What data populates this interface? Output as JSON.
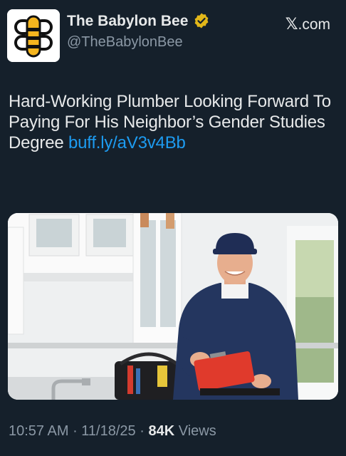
{
  "account": {
    "display_name": "The Babylon Bee",
    "handle": "@TheBabylonBee",
    "verified_icon": "gold-verified-badge-icon",
    "avatar_icon": "bee-logo-icon"
  },
  "source": {
    "x_glyph": "𝕏",
    "label": ".com"
  },
  "tweet": {
    "text": "Hard-Working Plumber Looking Forward To Paying For His Neighbor’s Gender Studies Degree ",
    "link": "buff.ly/aV3v4Bb"
  },
  "media": {
    "subject": "plumber-photo"
  },
  "meta": {
    "time": "10:57 AM",
    "sep1": " · ",
    "date": "11/18/25",
    "sep2": " · ",
    "views_count": "84K",
    "views_label": " Views"
  },
  "colors": {
    "background": "#15202b",
    "link": "#1d9bf0",
    "muted": "#8b98a5",
    "verified_gold": "#e2b719"
  }
}
